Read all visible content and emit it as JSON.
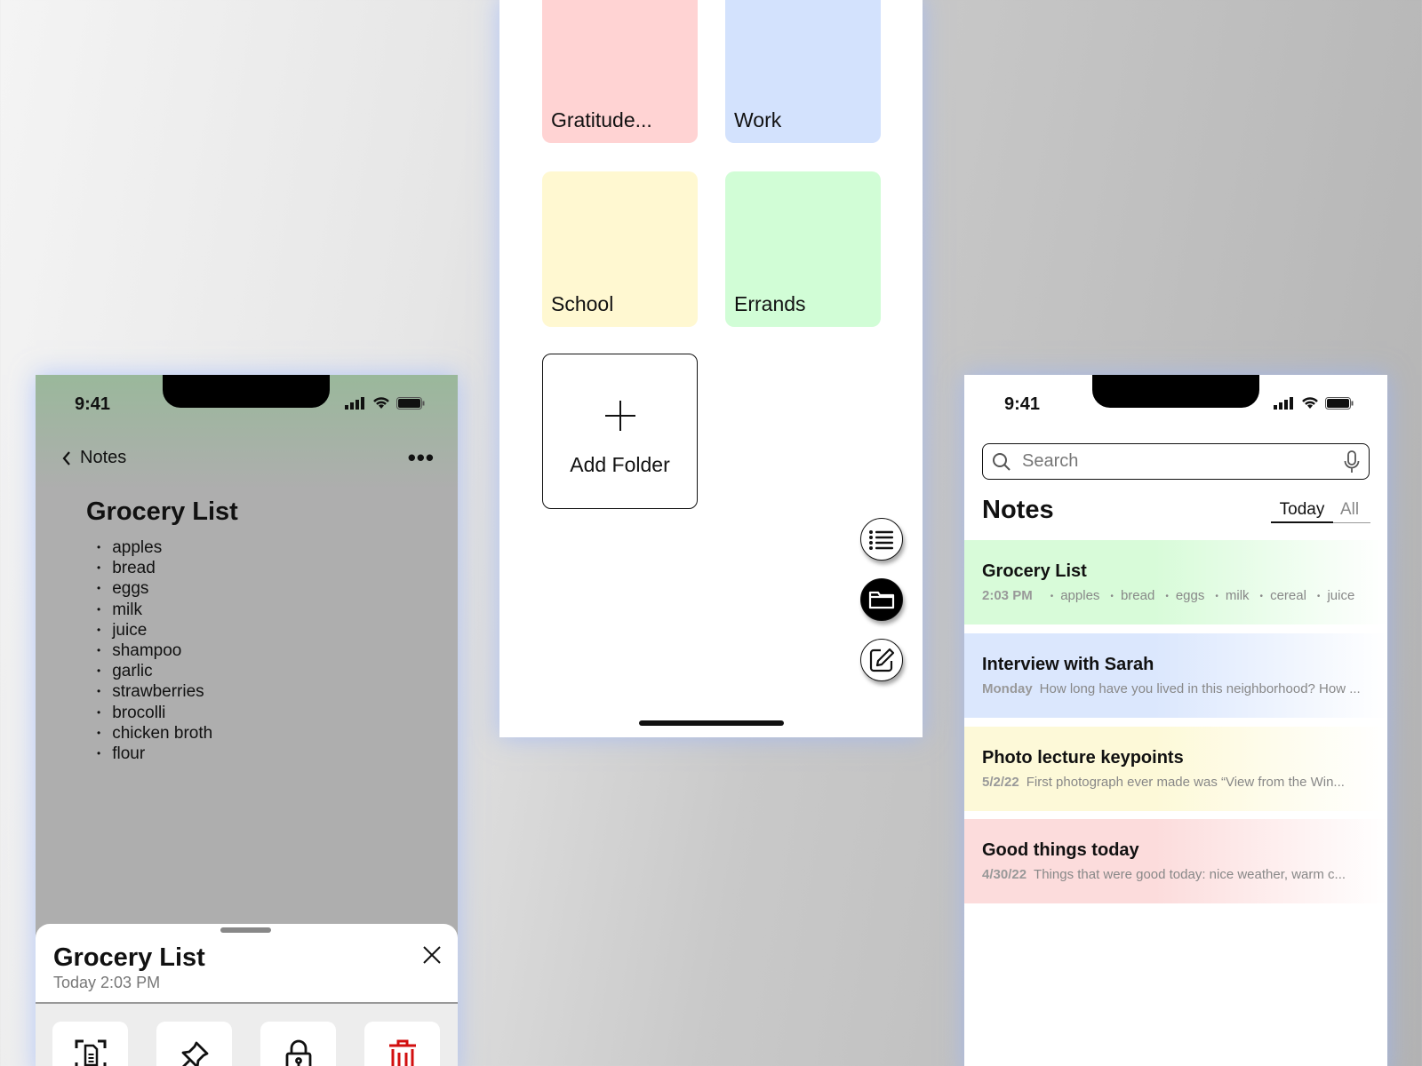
{
  "status": {
    "time": "9:41"
  },
  "detail": {
    "back_label": "Notes",
    "more_label": "•••",
    "title": "Grocery List",
    "items": [
      "apples",
      "bread",
      "eggs",
      "milk",
      "juice",
      "shampoo",
      "garlic",
      "strawberries",
      "brocolli",
      "chicken broth",
      "flour"
    ],
    "sheet": {
      "title": "Grocery List",
      "subtitle": "Today 2:03 PM",
      "actions": [
        {
          "icon": "scan-document-icon"
        },
        {
          "icon": "pin-icon"
        },
        {
          "icon": "lock-icon"
        },
        {
          "icon": "trash-icon",
          "color": "#d20f0f"
        }
      ]
    }
  },
  "folders": {
    "items": [
      {
        "label": "Gratitude...",
        "color": "#ffd3d3"
      },
      {
        "label": "Work",
        "color": "#d3e2fd"
      },
      {
        "label": "School",
        "color": "#fff8d1"
      },
      {
        "label": "Errands",
        "color": "#d1fdd6"
      }
    ],
    "add_label": "Add Folder",
    "fabs": [
      "list-icon",
      "folder-icon",
      "compose-icon"
    ]
  },
  "notes": {
    "search_placeholder": "Search",
    "heading": "Notes",
    "tabs": {
      "today": "Today",
      "all": "All"
    },
    "items": [
      {
        "title": "Grocery List",
        "date": "2:03 PM",
        "preview": [
          "apples",
          "bread",
          "eggs",
          "milk",
          "cereal",
          "juice"
        ],
        "color": "#d8fbd9"
      },
      {
        "title": "Interview with Sarah",
        "date": "Monday",
        "preview": "How long have you lived in this neighborhood? How ...",
        "color": "#dbe7fd"
      },
      {
        "title": "Photo lecture keypoints",
        "date": "5/2/22",
        "preview": "First photograph ever made was “View from the Win...",
        "color": "#fdf9d8"
      },
      {
        "title": "Good things today",
        "date": "4/30/22",
        "preview": "Things that were good today: nice weather, warm c...",
        "color": "#fcdcdc"
      }
    ]
  }
}
